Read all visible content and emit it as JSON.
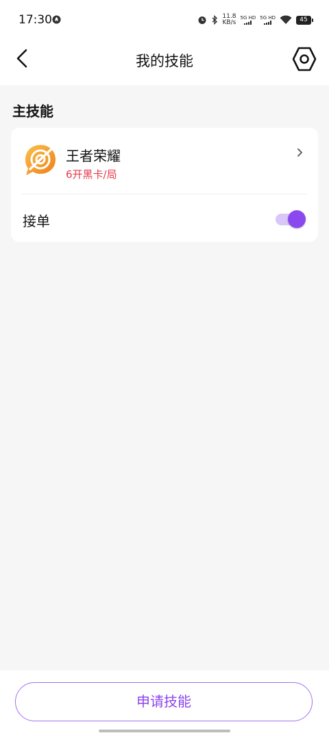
{
  "status_bar": {
    "time": "17:30",
    "speed_value": "11.8",
    "speed_unit": "KB/s",
    "sim1": "5G HD",
    "sim2": "5G HD",
    "battery": "45",
    "icons": [
      "flame-icon",
      "alarm-icon",
      "bluetooth-icon",
      "signal-icon",
      "wifi-icon",
      "battery-icon"
    ]
  },
  "nav": {
    "title": "我的技能",
    "back_icon": "chevron-left-icon",
    "settings_icon": "hexagon-settings-icon"
  },
  "section": {
    "title": "主技能"
  },
  "skill": {
    "name": "王者荣耀",
    "price": "6开黑卡/局",
    "icon": "game-logo-icon"
  },
  "order": {
    "label": "接单",
    "enabled": true
  },
  "footer": {
    "apply_label": "申请技能"
  },
  "colors": {
    "accent": "#8c48ef",
    "price": "#e53a4a",
    "background": "#f6f6f6"
  }
}
